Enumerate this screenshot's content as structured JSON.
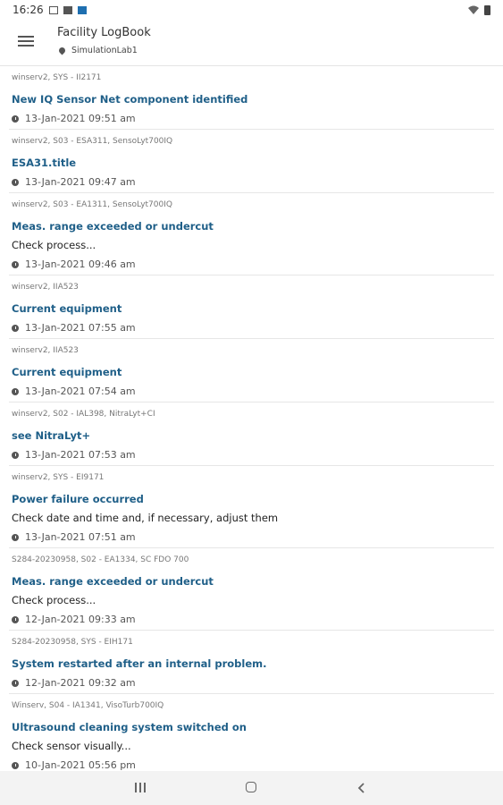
{
  "status_bar": {
    "time": "16:26"
  },
  "app_bar": {
    "title": "Facility LogBook",
    "location": "SimulationLab1"
  },
  "entries": [
    {
      "source": "winserv2, SYS - II2171",
      "title": "New IQ Sensor Net component identified",
      "desc": "",
      "time": "13-Jan-2021 09:51 am"
    },
    {
      "source": "winserv2, S03 - ESA311, SensoLyt700IQ",
      "title": "ESA31.title",
      "desc": "",
      "time": "13-Jan-2021 09:47 am"
    },
    {
      "source": "winserv2, S03 - EA1311, SensoLyt700IQ",
      "title": "Meas. range exceeded or undercut",
      "desc": "Check process...",
      "time": "13-Jan-2021 09:46 am"
    },
    {
      "source": "winserv2, IIA523",
      "title": "Current equipment",
      "desc": "",
      "time": "13-Jan-2021 07:55 am"
    },
    {
      "source": "winserv2, IIA523",
      "title": "Current equipment",
      "desc": "",
      "time": "13-Jan-2021 07:54 am"
    },
    {
      "source": "winserv2, S02 - IAL398, NitraLyt+CI",
      "title": "see NitraLyt+",
      "desc": "",
      "time": "13-Jan-2021 07:53 am"
    },
    {
      "source": "winserv2, SYS - EI9171",
      "title": "Power failure occurred",
      "desc": "Check date and time and, if necessary, adjust them",
      "time": "13-Jan-2021 07:51 am"
    },
    {
      "source": "S284-20230958, S02 - EA1334, SC FDO 700",
      "title": "Meas. range exceeded or undercut",
      "desc": "Check process...",
      "time": "12-Jan-2021 09:33 am"
    },
    {
      "source": "S284-20230958, SYS - EIH171",
      "title": "System restarted after an internal problem.",
      "desc": "",
      "time": "12-Jan-2021 09:32 am"
    },
    {
      "source": "Winserv, S04 - IA1341, VisoTurb700IQ",
      "title": "Ultrasound cleaning system switched on",
      "desc": "Check sensor visually...",
      "time": "10-Jan-2021 05:56 pm"
    }
  ]
}
